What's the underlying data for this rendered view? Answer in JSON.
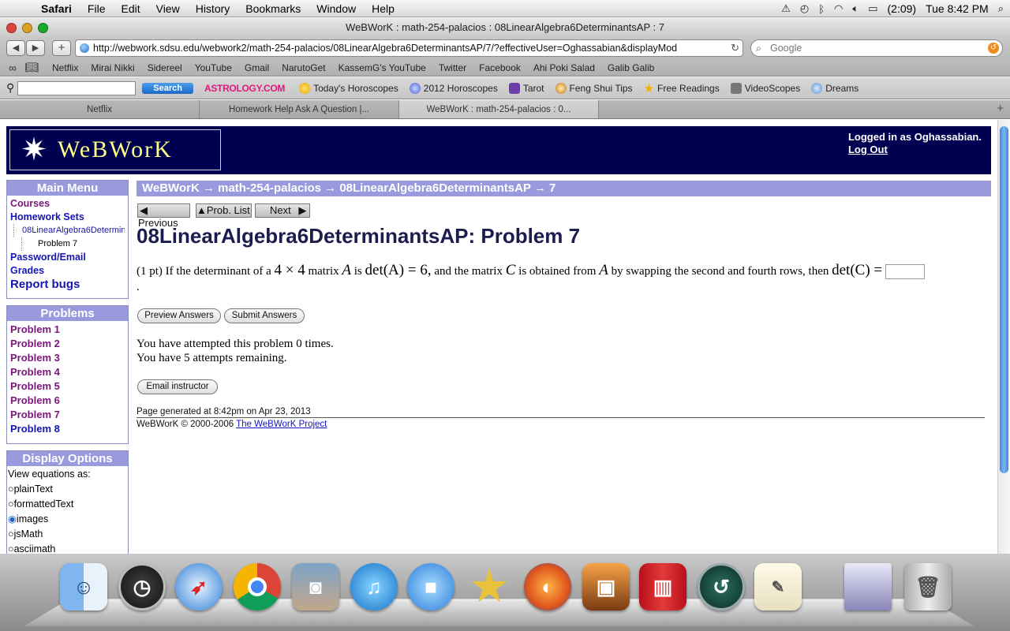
{
  "menubar": {
    "app": "Safari",
    "items": [
      "File",
      "Edit",
      "View",
      "History",
      "Bookmarks",
      "Window",
      "Help"
    ],
    "battery": "(2:09)",
    "clock": "Tue 8:42 PM"
  },
  "window": {
    "title": "WeBWorK : math-254-palacios : 08LinearAlgebra6DeterminantsAP : 7"
  },
  "toolbar": {
    "url": "http://webwork.sdsu.edu/webwork2/math-254-palacios/08LinearAlgebra6DeterminantsAP/7/?effectiveUser=Oghassabian&displayMod",
    "search_placeholder": "Google"
  },
  "bookmarks": [
    "Netflix",
    "Mirai Nikki",
    "Sidereel",
    "YouTube",
    "Gmail",
    "NarutoGet",
    "KassemG's YouTube",
    "Twitter",
    "Facebook",
    "Ahi Poki Salad",
    "Galib Galib"
  ],
  "astrobar": {
    "search_label": "Search",
    "logo": "ASTROLOGY.COM",
    "items": [
      "Today's Horoscopes",
      "2012 Horoscopes",
      "Tarot",
      "Feng Shui Tips",
      "Free Readings",
      "VideoScopes",
      "Dreams"
    ]
  },
  "tabs": [
    "Netflix",
    "Homework Help Ask A Question |...",
    "WeBWorK : math-254-palacios : 0..."
  ],
  "page": {
    "logo_text": "WeBWorK",
    "logged_in": "Logged in as Oghassabian.",
    "logout": "Log Out",
    "main_menu_title": "Main Menu",
    "menu": {
      "courses": "Courses",
      "homework_sets": "Homework Sets",
      "set": "08LinearAlgebra6DeterminantsAP",
      "problem": "Problem 7",
      "password": "Password/Email",
      "grades": "Grades",
      "report": "Report bugs"
    },
    "problems_title": "Problems",
    "problems": [
      "Problem 1",
      "Problem 2",
      "Problem 3",
      "Problem 4",
      "Problem 5",
      "Problem 6",
      "Problem 7",
      "Problem 8"
    ],
    "display_title": "Display Options",
    "view_label": "View equations as:",
    "display_options": [
      "plainText",
      "formattedText",
      "images",
      "jsMath",
      "asciimath"
    ],
    "display_selected": "images",
    "breadcrumb": "WeBWorK → math-254-palacios → 08LinearAlgebra6DeterminantsAP → 7",
    "nav": {
      "previous": "Previous",
      "list": "Prob. List",
      "next": "Next"
    },
    "title": "08LinearAlgebra6DeterminantsAP: Problem 7",
    "problem": {
      "pts": "(1 pt) If the determinant of a",
      "dim": "4 × 4",
      "t2": "matrix",
      "A": "A",
      "t3": "is",
      "detA": "det(A) = 6,",
      "t4": "and the matrix",
      "C": "C",
      "t5": "is obtained from",
      "t6": "by swapping the second and fourth rows, then",
      "detC": "det(C) =",
      "end": "."
    },
    "preview_button": "Preview Answers",
    "submit_button": "Submit Answers",
    "attempts_line1": "You have attempted this problem 0 times.",
    "attempts_line2": "You have 5 attempts remaining.",
    "email_button": "Email instructor",
    "generated": "Page generated at 8:42pm on Apr 23, 2013",
    "copyright": "WeBWorK © 2000-2006",
    "project_link": "The WeBWorK Project"
  },
  "colors": {
    "header_bg": "#000050",
    "panel_header": "#9999dd",
    "link": "#1515b0",
    "visited": "#7a157a"
  }
}
